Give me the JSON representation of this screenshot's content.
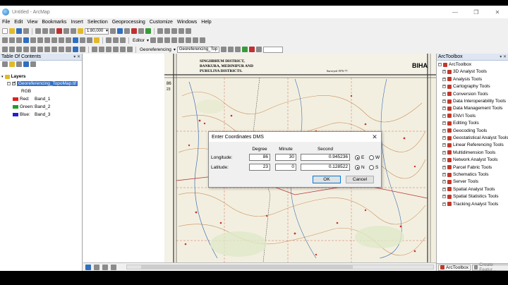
{
  "window": {
    "title": "Untitled - ArcMap"
  },
  "menu": [
    "File",
    "Edit",
    "View",
    "Bookmarks",
    "Insert",
    "Selection",
    "Geoprocessing",
    "Customize",
    "Windows",
    "Help"
  ],
  "toolbar": {
    "scale": "1:80,000",
    "editor_label": "Editor",
    "georef_label": "Georeferencing",
    "georef_layer": "Georeferencing_Top"
  },
  "toc": {
    "title": "Table Of Contents",
    "root": "Layers",
    "layer": "Georeferencing_TopoMap.tif",
    "rgb": "RGB",
    "bands": [
      {
        "label": "Red:",
        "band": "Band_1",
        "color": "#e02020"
      },
      {
        "label": "Green:",
        "band": "Band_2",
        "color": "#20a020"
      },
      {
        "label": "Blue:",
        "band": "Band_3",
        "color": "#2020d0"
      }
    ]
  },
  "map": {
    "header_lines": [
      "SINGHBHUM DISTRICT,",
      "BANKURA, MEDINIPUR AND",
      "PURULIYA DISTRICTS."
    ],
    "corner_label": "BIHA",
    "survey_note": "Surveyed 1976-77.",
    "grid_label_left": "86",
    "grid_label_sub": "23"
  },
  "toolbox": {
    "title": "ArcToolbox",
    "root": "ArcToolbox",
    "items": [
      "3D Analyst Tools",
      "Analysis Tools",
      "Cartography Tools",
      "Conversion Tools",
      "Data Interoperability Tools",
      "Data Management Tools",
      "ENVI Tools",
      "Editing Tools",
      "Geocoding Tools",
      "Geostatistical Analyst Tools",
      "Linear Referencing Tools",
      "Multidimension Tools",
      "Network Analyst Tools",
      "Parcel Fabric Tools",
      "Schematics Tools",
      "Server Tools",
      "Spatial Analyst Tools",
      "Spatial Statistics Tools",
      "Tracking Analyst Tools"
    ],
    "tabs": [
      "ArcToolbox",
      "Create Featur..."
    ]
  },
  "dialog": {
    "title": "Enter Coordinates DMS",
    "headers": {
      "degree": "Degree",
      "minute": "Minute",
      "second": "Second"
    },
    "longitude": {
      "label": "Longitude:",
      "degree": "86",
      "minute": "30",
      "second": "0.945236",
      "dir1": "E",
      "dir2": "W",
      "selected": "E"
    },
    "latitude": {
      "label": "Latitude:",
      "degree": "23",
      "minute": "0",
      "second": "0.128522",
      "dir1": "N",
      "dir2": "S",
      "selected": "N"
    },
    "ok": "OK",
    "cancel": "Cancel"
  }
}
